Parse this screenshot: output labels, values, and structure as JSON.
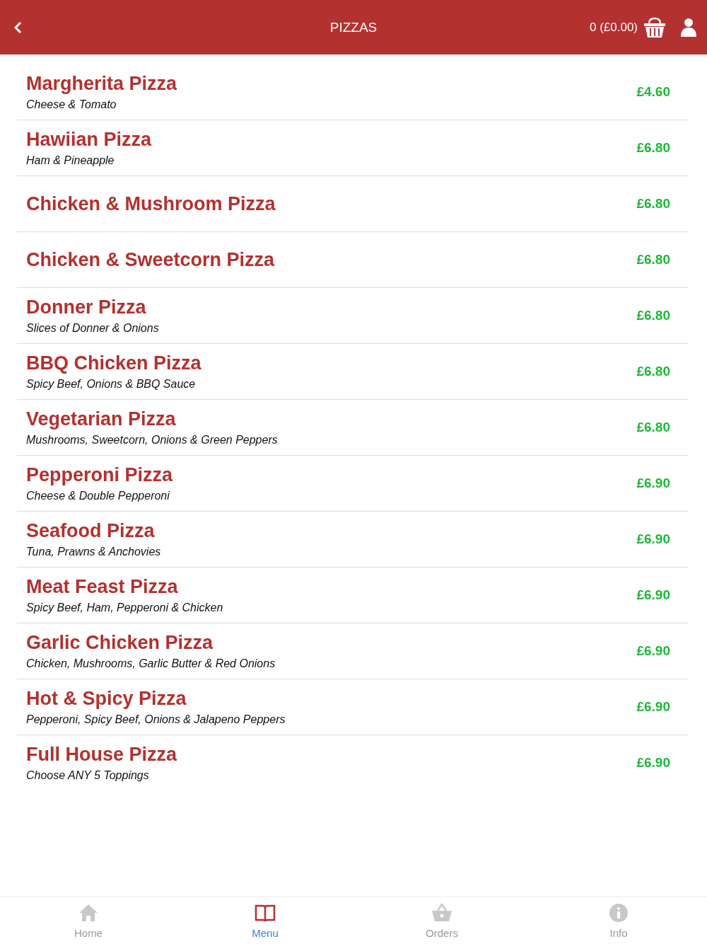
{
  "header": {
    "title": "PIZZAS",
    "basket_summary": "0 (£0.00)"
  },
  "items": [
    {
      "name": "Margherita Pizza",
      "description": "Cheese & Tomato",
      "price": "£4.60"
    },
    {
      "name": "Hawiian Pizza",
      "description": "Ham & Pineapple",
      "price": "£6.80"
    },
    {
      "name": "Chicken & Mushroom Pizza",
      "price": "£6.80"
    },
    {
      "name": "Chicken & Sweetcorn Pizza",
      "price": "£6.80"
    },
    {
      "name": "Donner Pizza",
      "description": "Slices of Donner & Onions",
      "price": "£6.80"
    },
    {
      "name": "BBQ Chicken Pizza",
      "description": "Spicy Beef, Onions & BBQ Sauce",
      "price": "£6.80"
    },
    {
      "name": "Vegetarian Pizza",
      "description": "Mushrooms, Sweetcorn, Onions & Green Peppers",
      "price": "£6.80"
    },
    {
      "name": "Pepperoni Pizza",
      "description": "Cheese & Double Pepperoni",
      "price": "£6.90"
    },
    {
      "name": "Seafood Pizza",
      "description": "Tuna, Prawns & Anchovies",
      "price": "£6.90"
    },
    {
      "name": "Meat Feast Pizza",
      "description": "Spicy Beef, Ham, Pepperoni & Chicken",
      "price": "£6.90"
    },
    {
      "name": "Garlic Chicken Pizza",
      "description": "Chicken, Mushrooms, Garlic Butter & Red Onions",
      "price": "£6.90"
    },
    {
      "name": "Hot & Spicy Pizza",
      "description": "Pepperoni, Spicy Beef, Onions & Jalapeno Peppers",
      "price": "£6.90"
    },
    {
      "name": "Full House Pizza",
      "description": "Choose ANY 5 Toppings",
      "price": "£6.90"
    }
  ],
  "nav": [
    {
      "kind": "home",
      "label": "Home",
      "selected": false
    },
    {
      "kind": "menu",
      "label": "Menu",
      "selected": true
    },
    {
      "kind": "orders",
      "label": "Orders",
      "selected": false
    },
    {
      "kind": "info",
      "label": "Info",
      "selected": false
    }
  ]
}
